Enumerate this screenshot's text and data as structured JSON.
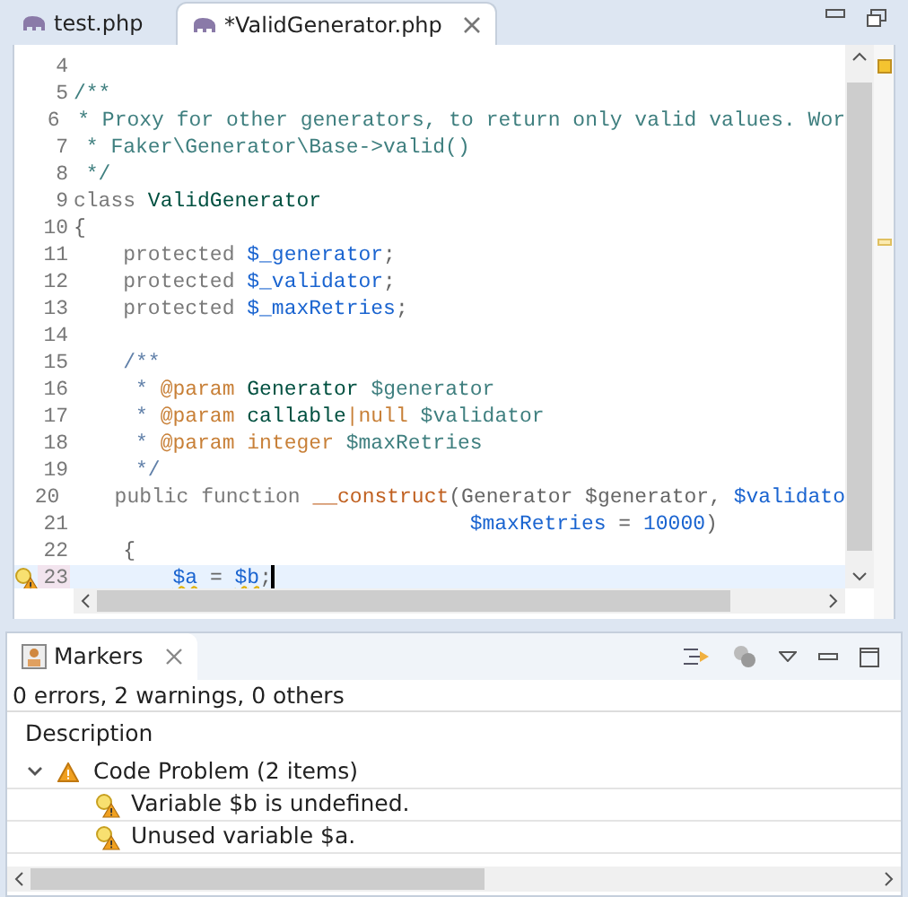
{
  "editor": {
    "tabs": [
      {
        "label": "test.php",
        "selected": false
      },
      {
        "label": "*ValidGenerator.php",
        "selected": true
      }
    ],
    "lines": [
      {
        "number": "4",
        "current": false
      },
      {
        "number": "5",
        "current": false,
        "tokens": [
          {
            "t": "/**",
            "kind": "doc"
          }
        ]
      },
      {
        "number": "6",
        "current": false,
        "tokens": [
          {
            "t": " * Proxy for other generators, to return only valid values. Wor",
            "kind": "doc"
          }
        ]
      },
      {
        "number": "7",
        "current": false,
        "tokens": [
          {
            "t": " * Faker\\Generator\\Base->valid()",
            "kind": "doc"
          }
        ]
      },
      {
        "number": "8",
        "current": false,
        "tokens": [
          {
            "t": " */",
            "kind": "doc"
          }
        ]
      },
      {
        "number": "9",
        "current": false,
        "tokens": [
          {
            "t": "class ",
            "kind": "keyword"
          },
          {
            "t": "ValidGenerator",
            "kind": "type"
          }
        ]
      },
      {
        "number": "10",
        "current": false,
        "tokens": [
          {
            "t": "{",
            "kind": "plain"
          }
        ]
      },
      {
        "number": "11",
        "current": false,
        "tokens": [
          {
            "t": "    protected ",
            "kind": "keyword"
          },
          {
            "t": "$_generator",
            "kind": "field"
          },
          {
            "t": ";",
            "kind": "plain"
          }
        ]
      },
      {
        "number": "12",
        "current": false,
        "tokens": [
          {
            "t": "    protected ",
            "kind": "keyword"
          },
          {
            "t": "$_validator",
            "kind": "field"
          },
          {
            "t": ";",
            "kind": "plain"
          }
        ]
      },
      {
        "number": "13",
        "current": false,
        "tokens": [
          {
            "t": "    protected ",
            "kind": "keyword"
          },
          {
            "t": "$_maxRetries",
            "kind": "field"
          },
          {
            "t": ";",
            "kind": "plain"
          }
        ]
      },
      {
        "number": "14",
        "current": false
      },
      {
        "number": "15",
        "current": false,
        "tokens": [
          {
            "t": "    /**",
            "kind": "comment"
          }
        ]
      },
      {
        "number": "16",
        "current": false,
        "tokens": [
          {
            "t": "     * ",
            "kind": "comment"
          },
          {
            "t": "@param",
            "kind": "tag"
          },
          {
            "t": " Generator",
            "kind": "type"
          },
          {
            "t": " $generator",
            "kind": "doc"
          }
        ]
      },
      {
        "number": "17",
        "current": false,
        "tokens": [
          {
            "t": "     * ",
            "kind": "comment"
          },
          {
            "t": "@param",
            "kind": "tag"
          },
          {
            "t": " callable",
            "kind": "type"
          },
          {
            "t": "|null",
            "kind": "tag"
          },
          {
            "t": " $validator",
            "kind": "doc"
          }
        ]
      },
      {
        "number": "18",
        "current": false,
        "tokens": [
          {
            "t": "     * ",
            "kind": "comment"
          },
          {
            "t": "@param",
            "kind": "tag"
          },
          {
            "t": " integer",
            "kind": "tag"
          },
          {
            "t": " $maxRetries",
            "kind": "doc"
          }
        ]
      },
      {
        "number": "19",
        "current": false,
        "tokens": [
          {
            "t": "     */",
            "kind": "comment"
          }
        ]
      },
      {
        "number": "20",
        "current": false,
        "tokens": [
          {
            "t": "    public function ",
            "kind": "keyword"
          },
          {
            "t": "__construct",
            "kind": "method"
          },
          {
            "t": "(Generator $generator, ",
            "kind": "plain"
          },
          {
            "t": "$validato",
            "kind": "field"
          }
        ]
      },
      {
        "number": "21",
        "current": false,
        "tokens": [
          {
            "t": "                                $maxRetries",
            "kind": "field"
          },
          {
            "t": " = ",
            "kind": "plain"
          },
          {
            "t": "10000",
            "kind": "number"
          },
          {
            "t": ")",
            "kind": "plain"
          }
        ]
      },
      {
        "number": "22",
        "current": false,
        "tokens": [
          {
            "t": "    {",
            "kind": "plain"
          }
        ]
      },
      {
        "number": "23",
        "current": true,
        "warning": true,
        "tokens": [
          {
            "t": "        $a",
            "kind": "warn"
          },
          {
            "t": " = ",
            "kind": "plain"
          },
          {
            "t": "$b",
            "kind": "warn"
          },
          {
            "t": ";",
            "kind": "plain"
          }
        ]
      }
    ]
  },
  "markers": {
    "tab": {
      "label": "Markers",
      "selected": true
    },
    "summary": "0 errors, 2 warnings, 0 others",
    "columns": [
      "Description"
    ],
    "tree": [
      {
        "label": "Code Problem (2 items)",
        "expanded": true,
        "children": [
          {
            "label": "Variable $b is undefined."
          },
          {
            "label": "Unused variable $a."
          }
        ]
      }
    ]
  }
}
